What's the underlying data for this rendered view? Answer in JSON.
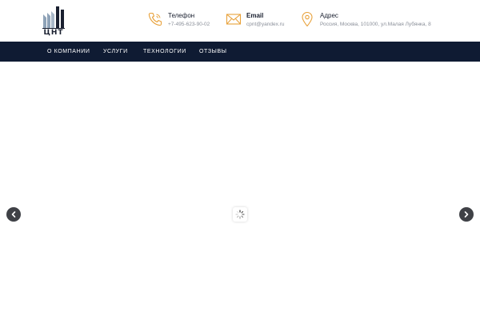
{
  "brand": {
    "logo_text": "ЦНТ",
    "logo_color": "#1a2030",
    "logo_accent": "#8fa3b8"
  },
  "contacts": {
    "phone": {
      "icon": "phone-icon",
      "title": "Телефон",
      "value": "+7-495-623-90-02"
    },
    "email": {
      "icon": "envelope-icon",
      "title": "Email",
      "value": "cpnt@yandex.ru"
    },
    "address": {
      "icon": "map-pin-icon",
      "title": "Адрес",
      "value": "Россия, Москва, 101000, ул.Малая Лубянка, 8"
    }
  },
  "nav": {
    "items": [
      {
        "label": "О КОМПАНИИ"
      },
      {
        "label": "УСЛУГИ"
      },
      {
        "label": "ТЕХНОЛОГИИ"
      },
      {
        "label": "ОТЗЫВЫ"
      }
    ]
  },
  "slider": {
    "prev_icon": "chevron-left-icon",
    "next_icon": "chevron-right-icon",
    "loader_icon": "spinner-icon"
  },
  "colors": {
    "accent": "#e8a13a",
    "nav_bg": "#0f1b33",
    "arrow_bg": "#3f4146"
  }
}
